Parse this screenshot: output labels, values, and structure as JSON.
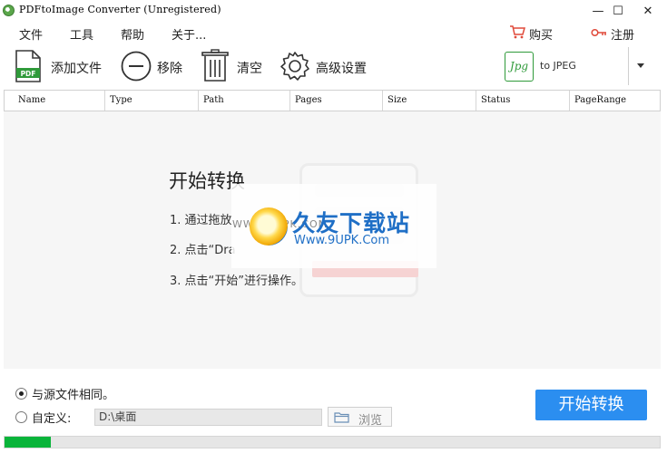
{
  "window": {
    "title": "PDFtoImage Converter (Unregistered)",
    "minimize": "—",
    "maximize": "☐",
    "close": "✕"
  },
  "menu": {
    "items": [
      "文件",
      "工具",
      "帮助",
      "关于..."
    ],
    "buy": "购买",
    "register": "注册"
  },
  "toolbar": {
    "add": "添加文件",
    "add_icon_text": "PDF",
    "remove": "移除",
    "clear": "清空",
    "settings": "高级设置",
    "format_badge": "Jpg",
    "format_label": "to JPEG"
  },
  "table": {
    "columns": [
      "Name",
      "Type",
      "Path",
      "Pages",
      "Size",
      "Status",
      "PageRange"
    ]
  },
  "guide": {
    "title": "开始转换",
    "steps": [
      "1. 通过拖放",
      "2. 点击“Dra",
      "3. 点击“开始”进行操作。"
    ]
  },
  "watermark": {
    "title": "久友下载站",
    "url": "Www.9UPK.Com",
    "small": "WWW.9UPK.COM"
  },
  "output": {
    "same_as_source": "与源文件相同。",
    "same_selected": true,
    "custom": "自定义:",
    "custom_path": "D:\\桌面",
    "browse": "浏览"
  },
  "actions": {
    "start": "开始转换"
  },
  "progress": {
    "value": 0.07
  },
  "colors": {
    "accent": "#2b8ef0",
    "progress": "#09b43a",
    "badge": "#2f9a3a"
  }
}
